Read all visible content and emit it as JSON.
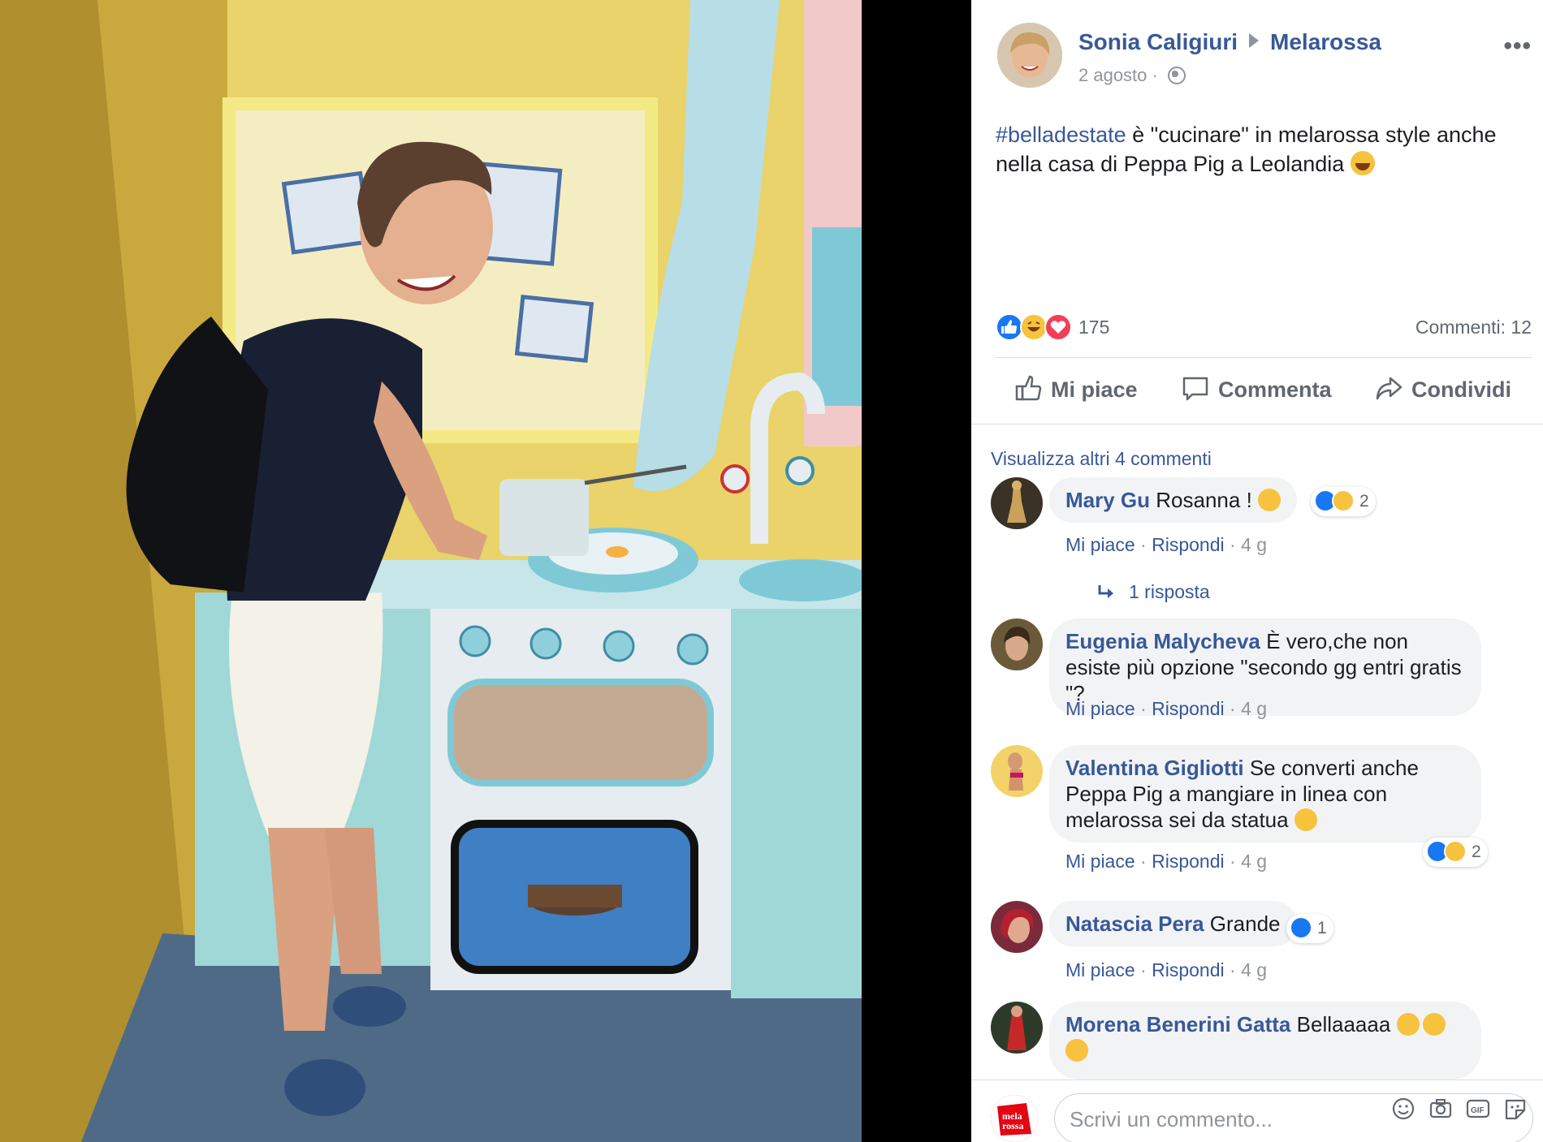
{
  "post": {
    "author": "Sonia Caligiuri",
    "page": "Melarossa",
    "date": "2 agosto",
    "date_sep": "·",
    "hashtag": "#belladestate",
    "text": " è \"cucinare\" in melarossa style anche nella casa di Peppa Pig a Leolandia ",
    "reactions_count": "175",
    "comments_count": "Commenti: 12"
  },
  "actions": {
    "like": "Mi piace",
    "comment": "Commenta",
    "share": "Condividi"
  },
  "comments_section": {
    "view_more": "Visualizza altri 4 commenti",
    "like_label": "Mi piace",
    "reply_label": "Rispondi",
    "sep": "·",
    "comments": [
      {
        "name": "Mary Gu",
        "text": "Rosanna ! ",
        "time": "4 g",
        "reaction_count": "2",
        "replies": "1 risposta"
      },
      {
        "name": "Eugenia Malycheva",
        "text": "È vero,che non esiste più opzione \"secondo gg entri gratis \"?",
        "time": "4 g"
      },
      {
        "name": "Valentina Gigliotti",
        "text": "Se converti anche Peppa Pig a mangiare in linea con melarossa sei da statua ",
        "time": "4 g",
        "reaction_count": "2"
      },
      {
        "name": "Natascia Pera",
        "text": "Grande",
        "time": "4 g",
        "reaction_count": "1"
      },
      {
        "name": "Morena Benerini Gatta",
        "text": "Bellaaaaa "
      }
    ]
  },
  "composer": {
    "placeholder": "Scrivi un commento...",
    "logo_text": "mela rossa.it"
  },
  "colors": {
    "link": "#385898",
    "secondary": "#90949c",
    "like_blue": "#1877f2",
    "haha_yellow": "#f7c23d",
    "love_red": "#f33e58"
  },
  "icons": [
    "more-icon",
    "globe-icon",
    "like-icon",
    "comment-icon",
    "share-icon",
    "reply-arrow-icon",
    "emoji-icon",
    "camera-icon",
    "gif-icon",
    "sticker-icon"
  ]
}
